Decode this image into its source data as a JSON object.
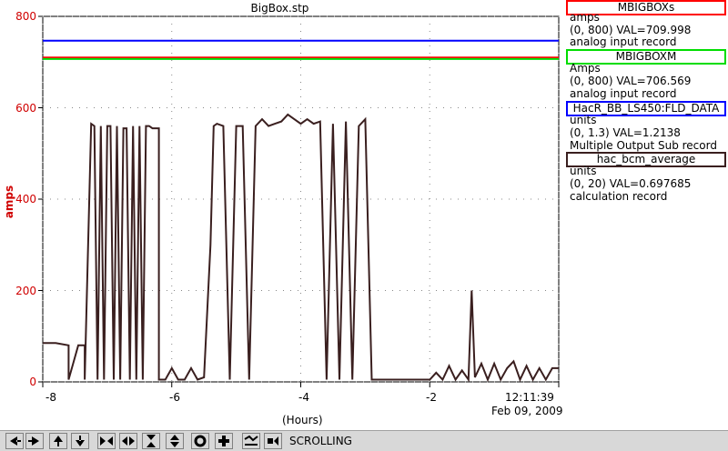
{
  "window_title": "BigBox.stp",
  "y_axis": {
    "label": "amps",
    "ticks": [
      "800",
      "600",
      "400",
      "200",
      "0"
    ]
  },
  "x_axis": {
    "label": "(Hours)",
    "ticks": [
      "-8",
      "-6",
      "-4",
      "-2"
    ],
    "time": "12:11:39",
    "date": "Feb 09, 2009"
  },
  "legend": [
    {
      "name": "MBIGBOXs",
      "units": "amps",
      "range_val": "(0, 800)  VAL=709.998",
      "record": "analog input record",
      "color": "#ff0000"
    },
    {
      "name": "MBIGBOXM",
      "units": "Amps",
      "range_val": "(0, 800)  VAL=706.569",
      "record": "analog input record",
      "color": "#00dd00"
    },
    {
      "name": "HacR_BB_LS450:FLD_DATA",
      "units": "units",
      "range_val": "(0, 1.3) VAL=1.2138",
      "record": "Multiple Output Sub record",
      "color": "#0000ff"
    },
    {
      "name": "hac_bcm_average",
      "units": "units",
      "range_val": "(0, 20) VAL=0.697685",
      "record": "calculation record",
      "color": "#3a1f1f"
    }
  ],
  "toolbar": {
    "status": "SCROLLING",
    "buttons": [
      {
        "name": "pan-left-icon",
        "glyph": "arrow-left"
      },
      {
        "name": "pan-right-icon",
        "glyph": "arrow-right"
      },
      {
        "name": "pan-up-icon",
        "glyph": "arrow-up"
      },
      {
        "name": "pan-down-icon",
        "glyph": "arrow-down"
      },
      {
        "name": "zoom-in-x-icon",
        "glyph": "zoom-in-x"
      },
      {
        "name": "zoom-out-x-icon",
        "glyph": "zoom-out-x"
      },
      {
        "name": "zoom-in-y-icon",
        "glyph": "zoom-in-y"
      },
      {
        "name": "zoom-out-y-icon",
        "glyph": "zoom-out-y"
      },
      {
        "name": "auto-scale-icon",
        "glyph": "circle"
      },
      {
        "name": "reset-icon",
        "glyph": "plus"
      },
      {
        "name": "stagger-icon",
        "glyph": "stagger"
      },
      {
        "name": "config-icon",
        "glyph": "config"
      }
    ]
  },
  "chart_data": {
    "type": "line",
    "xlabel": "(Hours)",
    "ylabel": "amps",
    "xlim": [
      -8,
      0
    ],
    "ylim": [
      0,
      800
    ],
    "series": [
      {
        "name": "MBIGBOXs",
        "color": "#ff0000",
        "x": [
          -8,
          0
        ],
        "y": [
          709.998,
          709.998
        ]
      },
      {
        "name": "MBIGBOXM",
        "color": "#00dd00",
        "x": [
          -8,
          0
        ],
        "y": [
          706.569,
          706.569
        ]
      },
      {
        "name": "HacR_BB_LS450:FLD_DATA",
        "color": "#0000ff",
        "x": [
          -8,
          0
        ],
        "y": [
          1.2138,
          1.2138
        ]
      },
      {
        "name": "hac_bcm_average",
        "color": "#3a1f1f",
        "x": [
          -8,
          -7.8,
          -7.6,
          -7.6,
          -7.45,
          -7.35,
          -7.35,
          -7.25,
          -7.2,
          -7.15,
          -7.1,
          -7.05,
          -7.0,
          -6.95,
          -6.9,
          -6.85,
          -6.8,
          -6.75,
          -6.7,
          -6.65,
          -6.6,
          -6.55,
          -6.5,
          -6.45,
          -6.4,
          -6.35,
          -6.3,
          -6.2,
          -6.2,
          -6.1,
          -6.0,
          -5.9,
          -5.8,
          -5.7,
          -5.6,
          -5.5,
          -5.4,
          -5.35,
          -5.3,
          -5.2,
          -5.1,
          -5.0,
          -4.9,
          -4.8,
          -4.7,
          -4.6,
          -4.5,
          -4.4,
          -4.3,
          -4.2,
          -4.1,
          -4.0,
          -3.9,
          -3.8,
          -3.7,
          -3.6,
          -3.5,
          -3.4,
          -3.3,
          -3.2,
          -3.1,
          -3.0,
          -2.9,
          -2.8,
          -2.7,
          -2.6,
          -2.5,
          -2.4,
          -2.3,
          -2.2,
          -2.1,
          -2.0,
          -1.9,
          -1.8,
          -1.7,
          -1.6,
          -1.5,
          -1.4,
          -1.35,
          -1.3,
          -1.2,
          -1.1,
          -1.0,
          -0.9,
          -0.8,
          -0.7,
          -0.6,
          -0.5,
          -0.4,
          -0.3,
          -0.2,
          -0.1,
          0
        ],
        "y": [
          85,
          85,
          80,
          5,
          80,
          80,
          5,
          565,
          560,
          5,
          560,
          5,
          560,
          560,
          5,
          560,
          5,
          555,
          555,
          5,
          560,
          5,
          560,
          5,
          560,
          560,
          555,
          555,
          5,
          5,
          30,
          5,
          5,
          30,
          5,
          10,
          300,
          560,
          565,
          560,
          5,
          560,
          560,
          5,
          560,
          575,
          560,
          565,
          570,
          585,
          575,
          565,
          575,
          565,
          570,
          5,
          565,
          5,
          570,
          5,
          560,
          575,
          5,
          5,
          5,
          5,
          5,
          5,
          5,
          5,
          5,
          5,
          20,
          5,
          35,
          5,
          25,
          5,
          200,
          10,
          40,
          5,
          40,
          5,
          30,
          45,
          5,
          35,
          5,
          30,
          5,
          30,
          30
        ]
      }
    ]
  }
}
